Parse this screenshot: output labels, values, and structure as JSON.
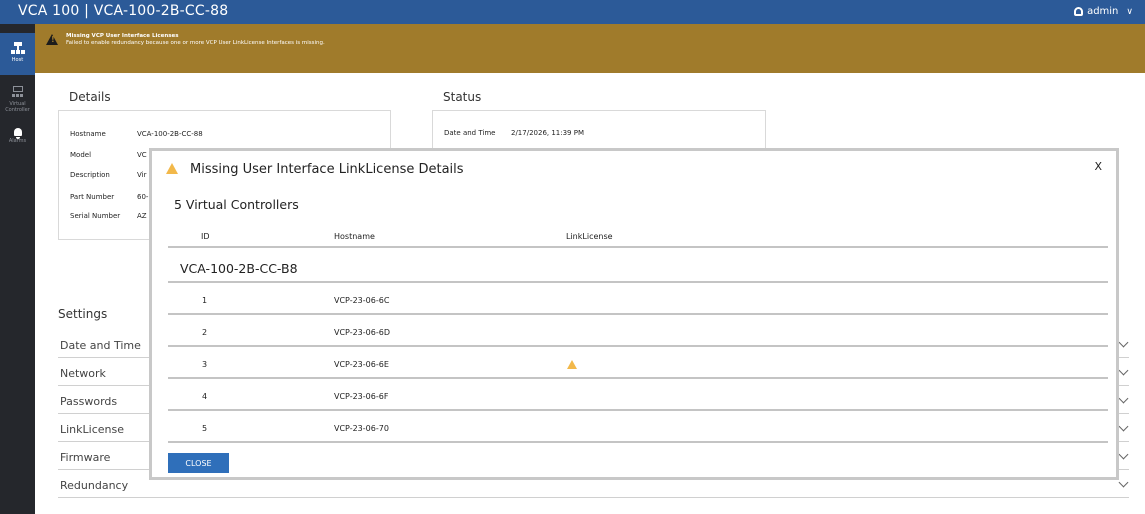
{
  "header": {
    "title": "VCA 100  |  VCA-100-2B-CC-88",
    "user": "admin"
  },
  "sidebar": {
    "items": [
      {
        "label": "Host"
      },
      {
        "label": "Virtual Controller"
      },
      {
        "label": "Alarms"
      }
    ]
  },
  "banner": {
    "title": "Missing VCP User Interface Licenses",
    "message": "Failed to enable redundancy because one or more VCP User LinkLicense Interfaces is missing."
  },
  "details": {
    "title": "Details",
    "fields": [
      {
        "label": "Hostname",
        "value": "VCA-100-2B-CC-88"
      },
      {
        "label": "Model",
        "value": "VC"
      },
      {
        "label": "Description",
        "value": "Vir"
      },
      {
        "label": "Part Number",
        "value": "60-"
      },
      {
        "label": "Serial Number",
        "value": "AZ"
      }
    ]
  },
  "status": {
    "title": "Status",
    "fields": [
      {
        "label": "Date and Time",
        "value": "2/17/2026, 11:39 PM"
      }
    ]
  },
  "settings": {
    "title": "Settings",
    "items": [
      {
        "label": "Date and Time"
      },
      {
        "label": "Network"
      },
      {
        "label": "Passwords"
      },
      {
        "label": "LinkLicense"
      },
      {
        "label": "Firmware"
      },
      {
        "label": "Redundancy"
      }
    ]
  },
  "modal": {
    "title": "Missing User Interface LinkLicense Details",
    "close_x": "X",
    "count": "5 Virtual Controllers",
    "columns": [
      "ID",
      "Hostname",
      "LinkLicense"
    ],
    "group": "VCA-100-2B-CC-B8",
    "rows": [
      {
        "id": "1",
        "hostname": "VCP-23-06-6C",
        "license_missing": false
      },
      {
        "id": "2",
        "hostname": "VCP-23-06-6D",
        "license_missing": false
      },
      {
        "id": "3",
        "hostname": "VCP-23-06-6E",
        "license_missing": true
      },
      {
        "id": "4",
        "hostname": "VCP-23-06-6F",
        "license_missing": false
      },
      {
        "id": "5",
        "hostname": "VCP-23-06-70",
        "license_missing": false
      }
    ],
    "close_button": "CLOSE"
  },
  "colors": {
    "header": "#2c5a98",
    "banner": "#a07b2b",
    "sidebar": "#25272c",
    "warning": "#f2b84a",
    "button": "#2f6fba"
  }
}
